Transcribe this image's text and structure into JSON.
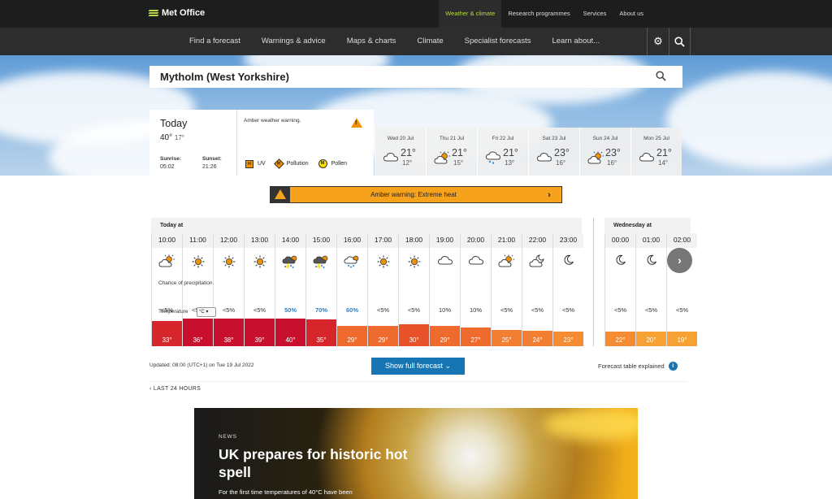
{
  "header": {
    "logo_text": "Met Office",
    "top_links": [
      "Weather & climate",
      "Research programmes",
      "Services",
      "About us"
    ],
    "nav_links": [
      "Find a forecast",
      "Warnings & advice",
      "Maps & charts",
      "Climate",
      "Specialist forecasts",
      "Learn about..."
    ]
  },
  "search": {
    "value": "Mytholm (West Yorkshire)"
  },
  "today": {
    "title": "Today",
    "high": "40°",
    "low": "17°",
    "sunrise_label": "Sunrise:",
    "sunrise": "05:02",
    "sunset_label": "Sunset:",
    "sunset": "21:26",
    "warning_text": "Amber weather warning.",
    "indicators": [
      {
        "letter": "H",
        "label": "UV"
      },
      {
        "letter": "M",
        "label": "Pollution"
      },
      {
        "letter": "M",
        "label": "Pollen"
      }
    ]
  },
  "days": [
    {
      "name": "Wed 20 Jul",
      "high": "21°",
      "low": "12°",
      "icon": "cloud-icon"
    },
    {
      "name": "Thu 21 Jul",
      "high": "21°",
      "low": "15°",
      "icon": "sun-cloud-icon"
    },
    {
      "name": "Fri 22 Jul",
      "high": "21°",
      "low": "13°",
      "icon": "rain-cloud-icon"
    },
    {
      "name": "Sat 23 Jul",
      "high": "23°",
      "low": "16°",
      "icon": "cloud-icon"
    },
    {
      "name": "Sun 24 Jul",
      "high": "23°",
      "low": "16°",
      "icon": "sun-cloud-icon"
    },
    {
      "name": "Mon 25 Jul",
      "high": "21°",
      "low": "14°",
      "icon": "cloud-icon"
    }
  ],
  "amber_banner": {
    "text": "Amber warning: Extreme heat"
  },
  "hourly": {
    "today_label": "Today at",
    "wed_label": "Wednesday at",
    "precip_label": "Chance of precipitation",
    "temp_label": "Temperature",
    "unit": "°C",
    "hours": [
      {
        "time": "10:00",
        "icon": "sun-cloud-icon",
        "precip": "<5%",
        "temp": "33°",
        "value": 33
      },
      {
        "time": "11:00",
        "icon": "sun-icon",
        "precip": "<5%",
        "temp": "36°",
        "value": 36
      },
      {
        "time": "12:00",
        "icon": "sun-icon",
        "precip": "<5%",
        "temp": "38°",
        "value": 38
      },
      {
        "time": "13:00",
        "icon": "sun-icon",
        "precip": "<5%",
        "temp": "39°",
        "value": 39
      },
      {
        "time": "14:00",
        "icon": "thunder-icon",
        "precip": "50%",
        "temp": "40°",
        "value": 40,
        "blue": true
      },
      {
        "time": "15:00",
        "icon": "thunder-icon",
        "precip": "70%",
        "temp": "35°",
        "value": 35,
        "blue": true
      },
      {
        "time": "16:00",
        "icon": "sun-rain-icon",
        "precip": "60%",
        "temp": "29°",
        "value": 29,
        "blue": true
      },
      {
        "time": "17:00",
        "icon": "sun-icon",
        "precip": "<5%",
        "temp": "29°",
        "value": 29
      },
      {
        "time": "18:00",
        "icon": "sun-icon",
        "precip": "<5%",
        "temp": "30°",
        "value": 30
      },
      {
        "time": "19:00",
        "icon": "cloud-icon",
        "precip": "10%",
        "temp": "29°",
        "value": 29
      },
      {
        "time": "20:00",
        "icon": "cloud-icon",
        "precip": "10%",
        "temp": "27°",
        "value": 27
      },
      {
        "time": "21:00",
        "icon": "sun-cloud-icon",
        "precip": "<5%",
        "temp": "25°",
        "value": 25
      },
      {
        "time": "22:00",
        "icon": "moon-cloud-icon",
        "precip": "<5%",
        "temp": "24°",
        "value": 24
      },
      {
        "time": "23:00",
        "icon": "moon-icon",
        "precip": "<5%",
        "temp": "23°",
        "value": 23
      }
    ],
    "wed_hours": [
      {
        "time": "00:00",
        "icon": "moon-icon",
        "precip": "<5%",
        "temp": "22°",
        "value": 22
      },
      {
        "time": "01:00",
        "icon": "moon-icon",
        "precip": "<5%",
        "temp": "20°",
        "value": 20
      },
      {
        "time": "02:00",
        "icon": "moon-icon",
        "precip": "<5%",
        "temp": "19°",
        "value": 19
      }
    ]
  },
  "footer": {
    "updated": "Updated: 08:00 (UTC+1) on Tue 19 Jul 2022",
    "show_button": "Show full forecast",
    "explained": "Forecast table explained",
    "last24": "LAST 24 HOURS"
  },
  "news": {
    "tag": "NEWS",
    "headline": "UK prepares for historic hot spell",
    "sub": "For the first time temperatures of 40°C have been"
  },
  "colors": {
    "accent": "#b6d94c",
    "amber": "#f7a21c",
    "blue_button": "#1775b4"
  }
}
